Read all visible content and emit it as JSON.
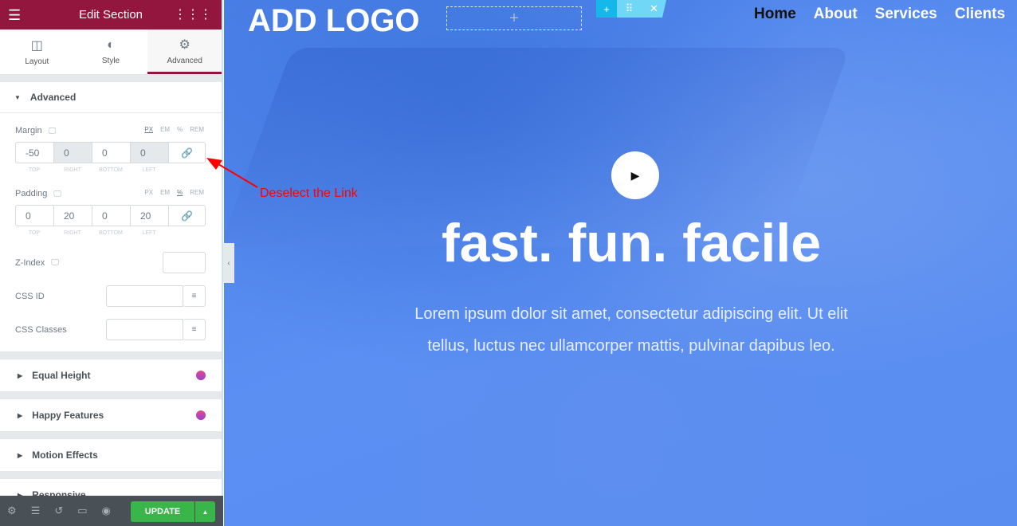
{
  "panel": {
    "title": "Edit Section",
    "tabs": [
      {
        "label": "Layout"
      },
      {
        "label": "Style"
      },
      {
        "label": "Advanced"
      }
    ],
    "section": "Advanced",
    "margin": {
      "label": "Margin",
      "units": [
        "PX",
        "EM",
        "%",
        "REM"
      ],
      "values": [
        "-50",
        "0",
        "0",
        "0"
      ],
      "sublabels": [
        "TOP",
        "RIGHT",
        "BOTTOM",
        "LEFT"
      ]
    },
    "padding": {
      "label": "Padding",
      "units": [
        "PX",
        "EM",
        "%",
        "REM"
      ],
      "values": [
        "0",
        "20",
        "0",
        "20"
      ],
      "sublabels": [
        "TOP",
        "RIGHT",
        "BOTTOM",
        "LEFT"
      ]
    },
    "zindex": "Z-Index",
    "cssid": "CSS ID",
    "cssclasses": "CSS Classes",
    "collapsed": [
      "Equal Height",
      "Happy Features",
      "Motion Effects",
      "Responsive"
    ],
    "update": "UPDATE"
  },
  "annotation": "Deselect the Link",
  "site": {
    "logo": "ADD LOGO",
    "nav": [
      "Home",
      "About",
      "Services",
      "Clients"
    ],
    "headline": "fast. fun. facile",
    "text1": "Lorem ipsum dolor sit amet, consectetur adipiscing elit. Ut elit",
    "text2": "tellus, luctus nec ullamcorper mattis, pulvinar dapibus leo."
  },
  "colors": {
    "brand": "#93163f",
    "update": "#39b54a",
    "annotation": "#ff0000"
  }
}
